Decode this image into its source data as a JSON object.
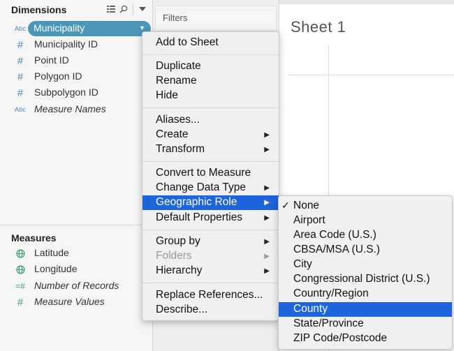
{
  "dimensions": {
    "title": "Dimensions",
    "fields": [
      {
        "type": "Abc",
        "name": "Municipality"
      },
      {
        "type": "#",
        "name": "Municipality ID"
      },
      {
        "type": "#",
        "name": "Point ID"
      },
      {
        "type": "#",
        "name": "Polygon ID"
      },
      {
        "type": "#",
        "name": "Subpolygon ID"
      },
      {
        "type": "Abc",
        "name": "Measure Names"
      }
    ]
  },
  "measures": {
    "title": "Measures",
    "fields": [
      {
        "type": "globe",
        "name": "Latitude"
      },
      {
        "type": "globe",
        "name": "Longitude"
      },
      {
        "type": "=#",
        "name": "Number of Records"
      },
      {
        "type": "#",
        "name": "Measure Values"
      }
    ]
  },
  "filters": {
    "label": "Filters"
  },
  "sheet": {
    "title": "Sheet 1"
  },
  "context_menu": {
    "items": [
      {
        "label": "Add to Sheet"
      },
      {
        "label": "Duplicate"
      },
      {
        "label": "Rename"
      },
      {
        "label": "Hide"
      },
      {
        "label": "Aliases..."
      },
      {
        "label": "Create",
        "submenu": true
      },
      {
        "label": "Transform",
        "submenu": true
      },
      {
        "label": "Convert to Measure"
      },
      {
        "label": "Change Data Type",
        "submenu": true
      },
      {
        "label": "Geographic Role",
        "submenu": true,
        "active": true
      },
      {
        "label": "Default Properties",
        "submenu": true
      },
      {
        "label": "Group by",
        "submenu": true
      },
      {
        "label": "Folders",
        "submenu": true,
        "disabled": true
      },
      {
        "label": "Hierarchy",
        "submenu": true
      },
      {
        "label": "Replace References..."
      },
      {
        "label": "Describe..."
      }
    ]
  },
  "geo_submenu": {
    "checkmark": "✓",
    "items": [
      {
        "label": "None",
        "checked": true
      },
      {
        "label": "Airport"
      },
      {
        "label": "Area Code (U.S.)"
      },
      {
        "label": "CBSA/MSA (U.S.)"
      },
      {
        "label": "City"
      },
      {
        "label": "Congressional District (U.S.)"
      },
      {
        "label": "Country/Region"
      },
      {
        "label": "County",
        "highlighted": true
      },
      {
        "label": "State/Province"
      },
      {
        "label": "ZIP Code/Postcode"
      }
    ]
  },
  "colors": {
    "pill": "#4a97b8",
    "highlight": "#1e64dc",
    "dimension_icon": "#4a86b4",
    "measure_icon": "#3fa06c"
  }
}
